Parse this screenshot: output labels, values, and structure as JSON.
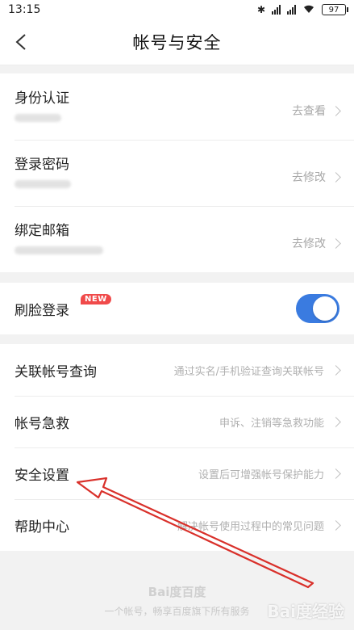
{
  "status_bar": {
    "time": "13:15",
    "battery": "97"
  },
  "header": {
    "title": "帐号与安全"
  },
  "account_rows": [
    {
      "label": "身份认证",
      "action": "去查看"
    },
    {
      "label": "登录密码",
      "action": "去修改"
    },
    {
      "label": "绑定邮箱",
      "action": "去修改"
    }
  ],
  "face_login": {
    "label": "刷脸登录",
    "badge": "NEW",
    "enabled": true
  },
  "menu_items": [
    {
      "label": "关联帐号查询",
      "desc": "通过实名/手机验证查询关联帐号"
    },
    {
      "label": "帐号急救",
      "desc": "申诉、注销等急救功能"
    },
    {
      "label": "安全设置",
      "desc": "设置后可增强帐号保护能力"
    },
    {
      "label": "帮助中心",
      "desc": "解决帐号使用过程中的常见问题"
    }
  ],
  "footer": {
    "logo": "Bai度百度",
    "text": "一个帐号，畅享百度旗下所有服务"
  },
  "watermark": "Bai度经验",
  "colors": {
    "accent": "#3a7be0",
    "badge": "#f04a4a",
    "arrow": "#d9302a"
  }
}
